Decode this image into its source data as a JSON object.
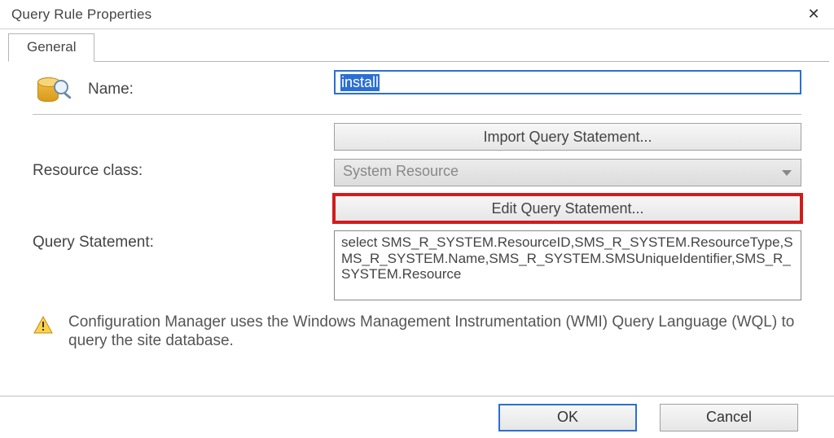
{
  "window": {
    "title": "Query Rule Properties"
  },
  "tabs": {
    "general": "General"
  },
  "form": {
    "name_label": "Name:",
    "name_value": "install",
    "import_button": "Import Query Statement...",
    "resource_class_label": "Resource class:",
    "resource_class_value": "System Resource",
    "edit_button": "Edit Query Statement...",
    "query_statement_label": "Query Statement:",
    "query_statement_value": "select SMS_R_SYSTEM.ResourceID,SMS_R_SYSTEM.ResourceType,SMS_R_SYSTEM.Name,SMS_R_SYSTEM.SMSUniqueIdentifier,SMS_R_SYSTEM.Resource"
  },
  "info": {
    "text": "Configuration Manager uses the Windows Management Instrumentation (WMI) Query Language (WQL) to query the site database."
  },
  "footer": {
    "ok": "OK",
    "cancel": "Cancel"
  }
}
